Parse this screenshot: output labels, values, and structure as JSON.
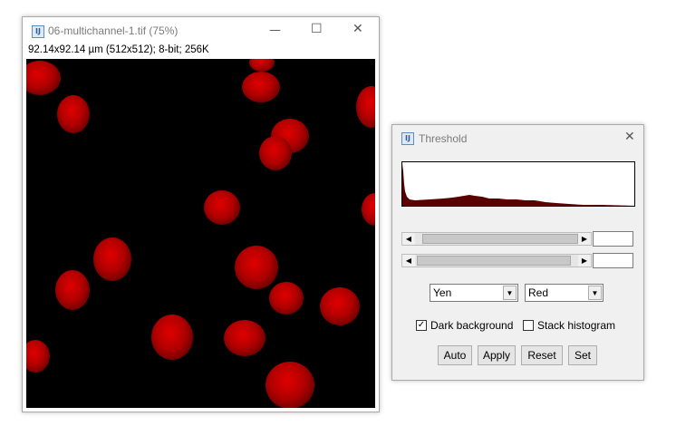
{
  "image_window": {
    "title": "06-multichannel-1.tif (75%)",
    "info": "92.14x92.14 µm (512x512); 8-bit; 256K",
    "icon": "imagej-icon",
    "controls": {
      "minimize": "—",
      "maximize": "☐",
      "close": "✕"
    }
  },
  "threshold_window": {
    "title": "Threshold",
    "icon": "imagej-icon",
    "close": "✕",
    "method": "Yen",
    "display_mode": "Red",
    "dark_background": {
      "label": "Dark background",
      "checked": true,
      "mark": "✓"
    },
    "stack_histogram": {
      "label": "Stack histogram",
      "checked": false,
      "mark": ""
    },
    "buttons": {
      "auto": "Auto",
      "apply": "Apply",
      "reset": "Reset",
      "set": "Set"
    },
    "lower_value": "",
    "upper_value": ""
  },
  "colors": {
    "channel": "#e00000",
    "canvas": "#000000"
  }
}
